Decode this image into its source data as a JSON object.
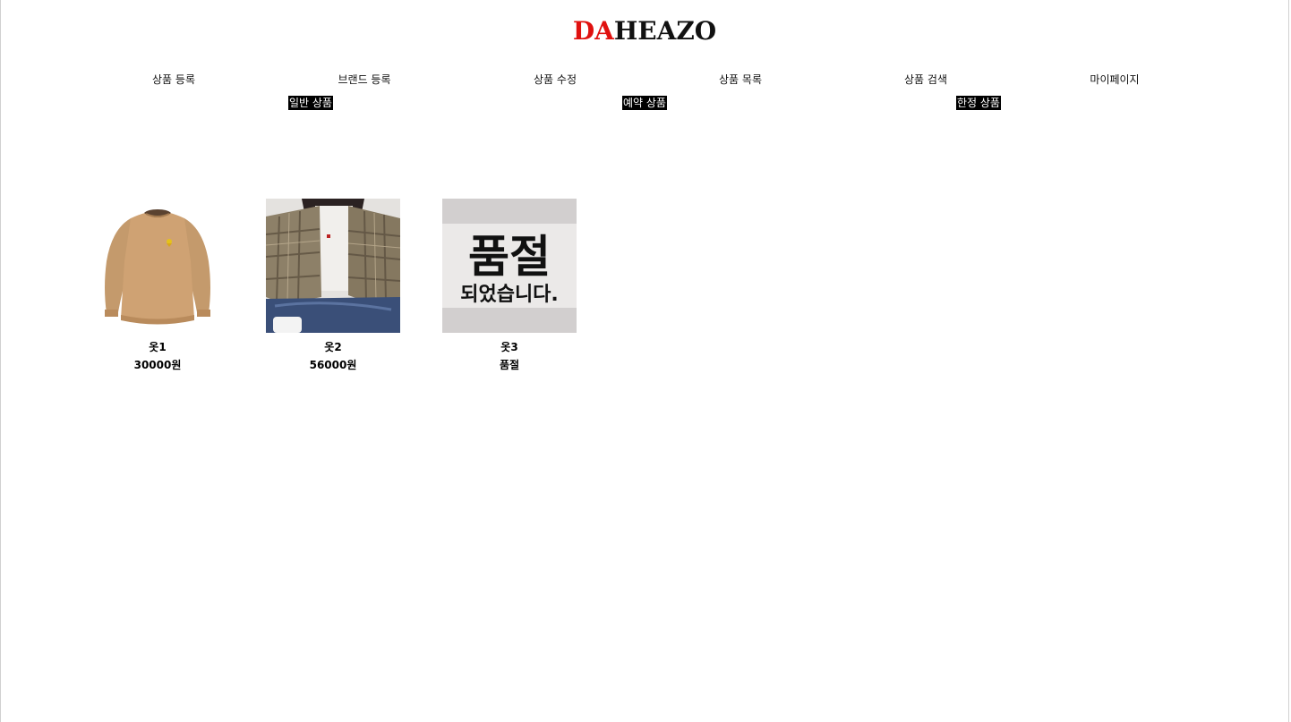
{
  "header": {
    "logo_accent": "DA",
    "logo_rest": "HEAZO",
    "accent_color": "#e0110f"
  },
  "nav": {
    "items": [
      {
        "label": "상품 등록"
      },
      {
        "label": "브랜드 등록"
      },
      {
        "label": "상품 수정"
      },
      {
        "label": "상품 목록"
      },
      {
        "label": "상품 검색"
      },
      {
        "label": "마이페이지"
      }
    ]
  },
  "subnav": {
    "items": [
      {
        "label": "일반 상품"
      },
      {
        "label": "예약 상품"
      },
      {
        "label": "한정 상품"
      }
    ]
  },
  "products": [
    {
      "name": "옷1",
      "price": "30000원",
      "image": "sweatshirt-photo"
    },
    {
      "name": "옷2",
      "price": "56000원",
      "image": "plaid-shirt-photo"
    },
    {
      "name": "옷3",
      "price": "품절",
      "image": "sold-out-image",
      "image_text_big": "품절",
      "image_text_small": "되었습니다."
    }
  ]
}
